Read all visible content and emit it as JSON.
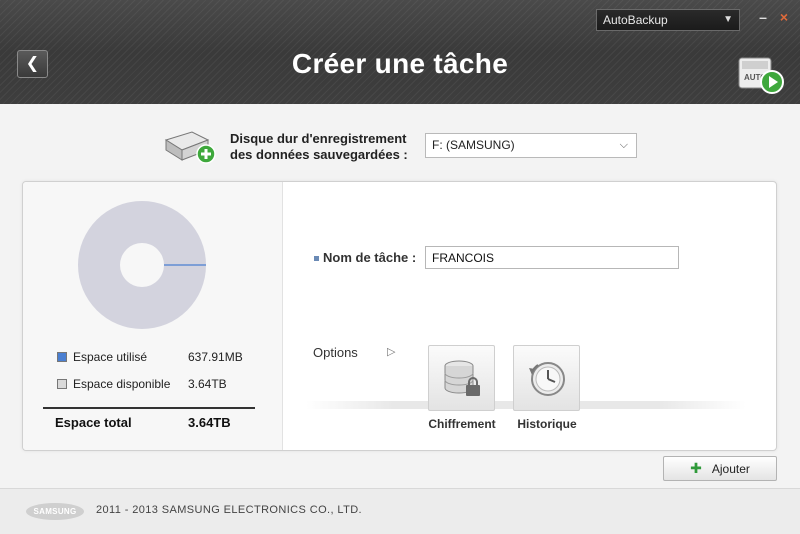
{
  "window": {
    "app_selector": "AutoBackup",
    "minimize_glyph": "–",
    "close_glyph": "×"
  },
  "header": {
    "back_glyph": "❮",
    "title": "Créer une tâche",
    "auto_icon_label": "AUTO"
  },
  "disk": {
    "label_line1": "Disque dur d'enregistrement",
    "label_line2": "des données sauvegardées :",
    "selected": "F: (SAMSUNG)"
  },
  "storage": {
    "used_label": "Espace utilisé",
    "used_value": "637.91MB",
    "used_color": "#4a7fd1",
    "available_label": "Espace disponible",
    "available_value": "3.64TB",
    "available_color": "#d9d9d9",
    "total_label": "Espace total",
    "total_value": "3.64TB",
    "used_fraction": 0.0002
  },
  "task": {
    "name_label": "Nom de tâche :",
    "name_value": "FRANCOIS"
  },
  "options": {
    "label": "Options",
    "arrow_glyph": "▷",
    "items": [
      {
        "label": "Chiffrement",
        "icon": "database-lock-icon"
      },
      {
        "label": "Historique",
        "icon": "clock-history-icon"
      }
    ]
  },
  "actions": {
    "add_label": "Ajouter",
    "add_glyph": "✚"
  },
  "footer": {
    "logo_text": "SAMSUNG",
    "copyright": "2011 - 2013 SAMSUNG ELECTRONICS CO., LTD."
  }
}
